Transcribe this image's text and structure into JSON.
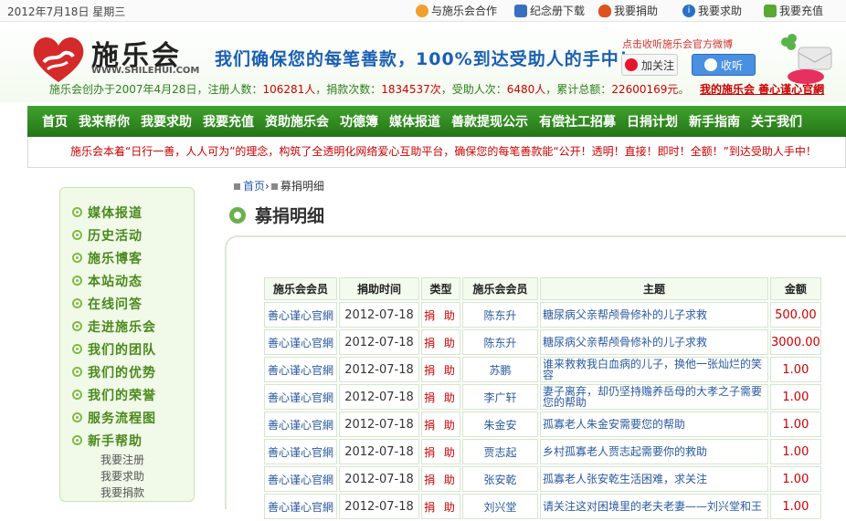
{
  "topbar": {
    "date": "2012年7月18日 星期三",
    "links": [
      {
        "label": "与施乐会合作",
        "color": "#f0a030"
      },
      {
        "label": "纪念册下载",
        "color": "#3a6fc0"
      },
      {
        "label": "我要捐助",
        "color": "#e05020"
      },
      {
        "label": "我要求助",
        "color": "#2a70c8"
      },
      {
        "label": "我要充值",
        "color": "#5aa830"
      }
    ]
  },
  "header": {
    "logo_name": "施乐会",
    "logo_url": "WWW.SHILEHUI.COM",
    "slogan": "我们确保您的每笔善款，100%到达受助人的手中！",
    "weibo_note": "点击收听施乐会官方微博",
    "follow_label": "加关注",
    "listen_label": "收听",
    "stats_prefix": "施乐会创办于2007年4月28日，注册人数：",
    "registered": "106281人",
    "donate_prefix": "，捐款次数：",
    "donations": "1834537次",
    "recip_prefix": "，受助人次：",
    "recipients": "6480人",
    "total_prefix": "，累计总额：",
    "total": "22600169元",
    "stats_suffix": "。",
    "my_link": "我的施乐会 善心谨心官網"
  },
  "nav": [
    "首页",
    "我来帮你",
    "我要求助",
    "我要充值",
    "资助施乐会",
    "功德簿",
    "媒体报道",
    "善款提现公示",
    "有偿社工招募",
    "日捐计划",
    "新手指南",
    "关于我们"
  ],
  "notice": "施乐会本着“日行一善，人人可为”的理念，构筑了全透明化网络爱心互助平台，确保您的每笔善款能“公开！透明！直接！即时！全额！”到达受助人手中！",
  "sidebar": {
    "items": [
      "媒体报道",
      "历史活动",
      "施乐博客",
      "本站动态",
      "在线问答",
      "走进施乐会",
      "我们的团队",
      "我们的优势",
      "我们的荣誉",
      "服务流程图",
      "新手帮助"
    ],
    "subitems": [
      "我要注册",
      "我要求助",
      "我要捐款"
    ]
  },
  "breadcrumb": {
    "home": "首页",
    "sep": "›",
    "current": "募捐明细"
  },
  "page_title": "募捐明细",
  "table": {
    "headers": [
      "施乐会会员",
      "捐助时间",
      "类型",
      "施乐会会员",
      "主题",
      "金额"
    ],
    "rows": [
      [
        "善心谨心官網",
        "2012-07-18",
        "捐 助",
        "陈东升",
        "糖尿病父亲帮颅骨修补的儿子求救",
        "500.00"
      ],
      [
        "善心谨心官網",
        "2012-07-18",
        "捐 助",
        "陈东升",
        "糖尿病父亲帮颅骨修补的儿子求救",
        "3000.00"
      ],
      [
        "善心谨心官網",
        "2012-07-18",
        "捐 助",
        "苏鹏",
        "谁来救救我白血病的儿子，换他一张灿烂的笑容",
        "1.00"
      ],
      [
        "善心谨心官網",
        "2012-07-18",
        "捐 助",
        "李广轩",
        "妻子离弃，却仍坚持赡养岳母的大孝之子需要您的帮助",
        "1.00"
      ],
      [
        "善心谨心官網",
        "2012-07-18",
        "捐 助",
        "朱金安",
        "孤寡老人朱金安需要您的帮助",
        "1.00"
      ],
      [
        "善心谨心官網",
        "2012-07-18",
        "捐 助",
        "贾志起",
        "乡村孤寡老人贾志起需要你的救助",
        "1.00"
      ],
      [
        "善心谨心官網",
        "2012-07-18",
        "捐 助",
        "张安乾",
        "孤寡老人张安乾生活困难，求关注",
        "1.00"
      ],
      [
        "善心谨心官網",
        "2012-07-18",
        "捐 助",
        "刘兴堂",
        "请关注这对困境里的老夫老妻——刘兴堂和王",
        "1.00"
      ]
    ]
  }
}
